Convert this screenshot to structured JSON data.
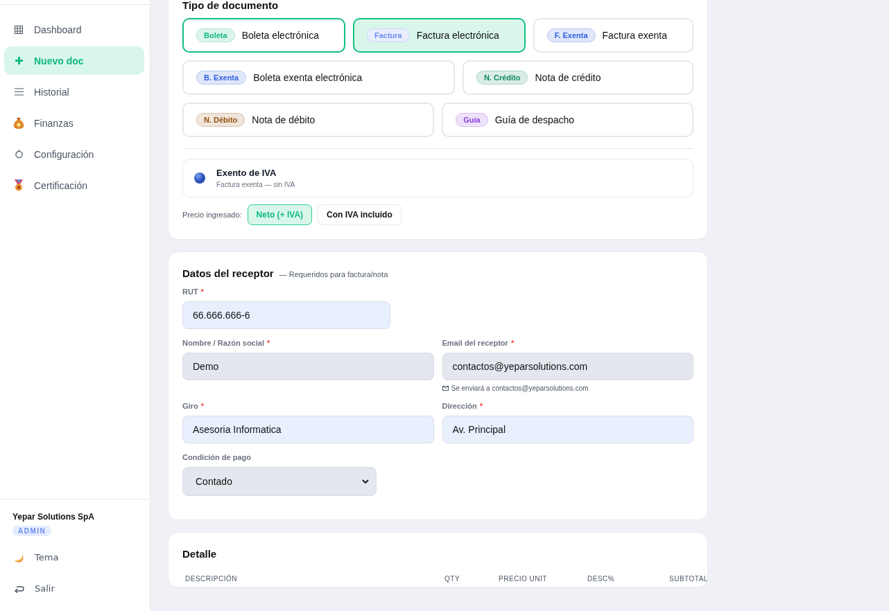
{
  "sidebar": {
    "items": [
      {
        "label": "Dashboard",
        "selected": false
      },
      {
        "label": "Nuevo doc",
        "selected": true
      },
      {
        "label": "Historial",
        "selected": false
      },
      {
        "label": "Finanzas",
        "selected": false
      },
      {
        "label": "Configuración",
        "selected": false
      },
      {
        "label": "Certificación",
        "selected": false
      }
    ],
    "company": "Yepar Solutions SpA",
    "role_badge": "ADMIN",
    "footer_items": [
      {
        "label": "Tema"
      },
      {
        "label": "Salir"
      }
    ]
  },
  "document_type": {
    "title": "Tipo de documento",
    "rows": [
      [
        {
          "badge": "Boleta",
          "label": "Boleta electrónica",
          "color": "#10b981",
          "selected": false,
          "outlined": true
        },
        {
          "badge": "Factura",
          "label": "Factura electrónica",
          "color": "#6b8cf0",
          "selected": true,
          "outlined": false
        },
        {
          "badge": "F. Exenta",
          "label": "Factura exenta",
          "color": "#2f5fe0",
          "selected": false,
          "outlined": false
        }
      ],
      [
        {
          "badge": "B. Exenta",
          "label": "Boleta exenta electrónica",
          "color": "#2f5fe0",
          "selected": false,
          "outlined": false
        },
        {
          "badge": "N. Crédito",
          "label": "Nota de crédito",
          "color": "#0f8a5f",
          "selected": false,
          "outlined": false
        }
      ],
      [
        {
          "badge": "N. Débito",
          "label": "Nota de débito",
          "color": "#92520e",
          "selected": false,
          "outlined": false
        },
        {
          "badge": "Guía",
          "label": "Guía de despacho",
          "color": "#8b3fd9",
          "selected": false,
          "outlined": false
        }
      ]
    ],
    "tax_status": {
      "title": "Exento de IVA",
      "subtitle": "Factura exenta — sin IVA"
    },
    "price_mode": {
      "label": "Precio ingresado:",
      "options": [
        {
          "label": "Neto (+ IVA)",
          "selected": true
        },
        {
          "label": "Con IVA incluido",
          "selected": false
        }
      ]
    }
  },
  "receptor": {
    "title": "Datos del receptor",
    "note": "— Requeridos para factura/nota",
    "rows": [
      [
        {
          "label": "RUT",
          "mark": "*",
          "kind": "input",
          "value": "66.666.666-6",
          "readonly": false
        }
      ],
      [
        {
          "label": "Nombre / Razón social",
          "mark": "*",
          "kind": "input",
          "value": "Demo",
          "readonly": true
        },
        {
          "label": "Email del receptor",
          "mark": "*",
          "kind": "input",
          "value": "contactos@yeparsolutions.com",
          "readonly": true,
          "hint": "Se enviará a contactos@yeparsolutions.com"
        }
      ],
      [
        {
          "label": "Giro",
          "mark": "*",
          "kind": "input",
          "value": "Asesoria Informatica",
          "readonly": false
        },
        {
          "label": "Dirección",
          "mark": "*",
          "kind": "input",
          "value": "Av. Principal",
          "readonly": false
        }
      ],
      [
        {
          "label": "Condición de pago",
          "kind": "select",
          "value": "Contado",
          "readonly": true
        }
      ]
    ]
  },
  "detail": {
    "title": "Detalle",
    "columns": [
      "DESCRIPCIÓN",
      "QTY",
      "PRECIO UNIT",
      "DESC%",
      "SUBTOTAL"
    ]
  }
}
